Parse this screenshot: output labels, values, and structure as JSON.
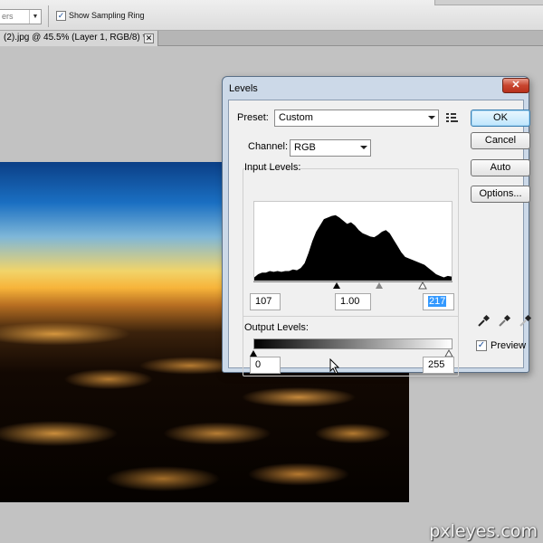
{
  "options_bar": {
    "sample_size_value": "ers",
    "show_sampling_ring_label": "Show Sampling Ring",
    "show_sampling_ring_checked": true
  },
  "document_tab": {
    "title": "(2).jpg @ 45.5% (Layer 1, RGB/8) *",
    "close_glyph": "✕"
  },
  "levels_dialog": {
    "title": "Levels",
    "close_glyph": "✕",
    "preset_label": "Preset:",
    "preset_value": "Custom",
    "channel_label": "Channel:",
    "channel_value": "RGB",
    "input_levels_label": "Input Levels:",
    "input_black": "107",
    "input_gamma": "1.00",
    "input_white": "217",
    "output_levels_label": "Output Levels:",
    "output_black": "0",
    "output_white": "255",
    "buttons": {
      "ok": "OK",
      "cancel": "Cancel",
      "auto": "Auto",
      "options": "Options..."
    },
    "preview_label": "Preview",
    "preview_checked": true,
    "icons": [
      "preset-options-icon",
      "black-point-eyedropper-icon",
      "gray-point-eyedropper-icon",
      "white-point-eyedropper-icon"
    ],
    "histogram": [
      4,
      8,
      10,
      10,
      12,
      11,
      12,
      11,
      12,
      12,
      14,
      13,
      16,
      22,
      35,
      50,
      62,
      70,
      78,
      80,
      82,
      83,
      80,
      76,
      72,
      74,
      70,
      64,
      60,
      58,
      56,
      55,
      58,
      62,
      64,
      60,
      52,
      44,
      36,
      30,
      28,
      26,
      24,
      22,
      20,
      16,
      12,
      8,
      6,
      4,
      6,
      5
    ],
    "input_slider_positions": [
      0.42,
      0.63,
      0.85
    ],
    "output_slider_positions": [
      0,
      1
    ]
  },
  "watermark": "pxleyes.com",
  "colors": {
    "dialog_frame": "#ccd9e8",
    "close_button": "#c8452f",
    "selection": "#3399ff"
  }
}
